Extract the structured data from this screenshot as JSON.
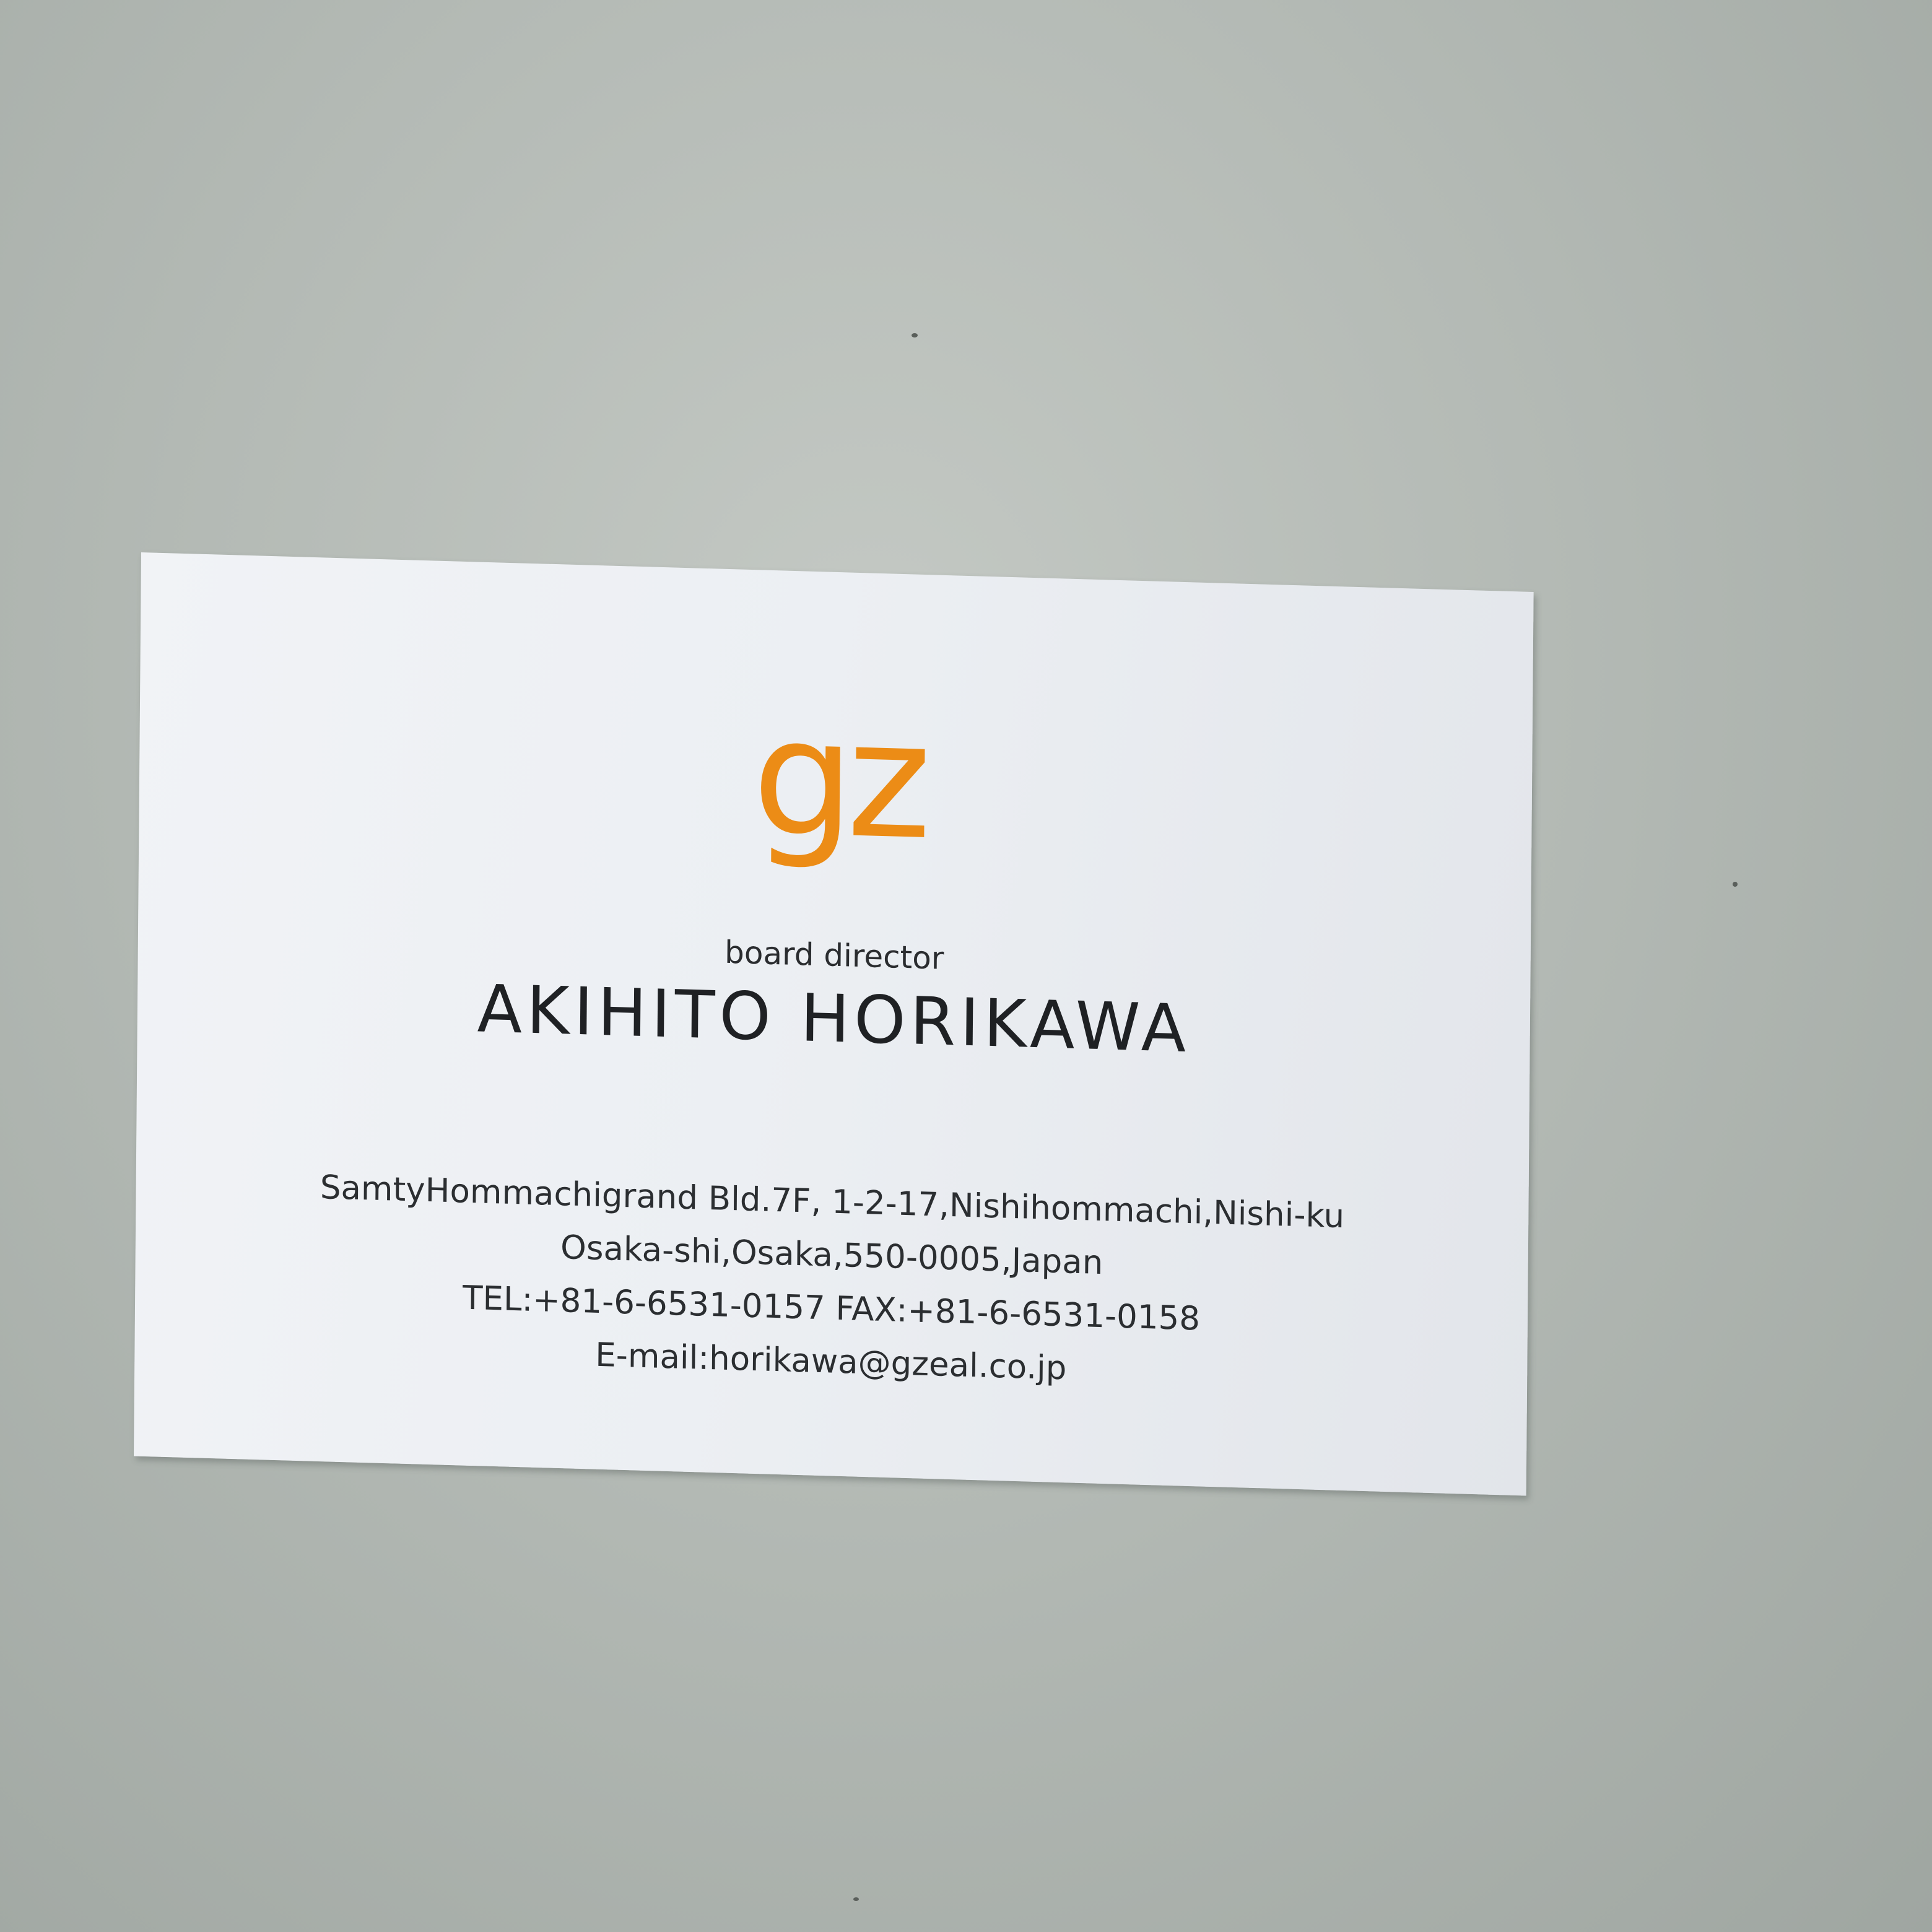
{
  "card": {
    "logo_text": "gz",
    "title": "board director",
    "name": "AKIHITO HORIKAWA",
    "address_line1": "SamtyHommachigrand Bld.7F, 1-2-17,Nishihommachi,Nishi-ku",
    "address_line2": "Osaka-shi,Osaka,550-0005,Japan",
    "phone_fax": "TEL:+81-6-6531-0157 FAX:+81-6-6531-0158",
    "email": "E-mail:horikawa@gzeal.co.jp"
  },
  "colors": {
    "logo": "#ec8c16",
    "text": "#1f2124",
    "card": "#eef0f3",
    "surface": "#b6bcb7"
  }
}
